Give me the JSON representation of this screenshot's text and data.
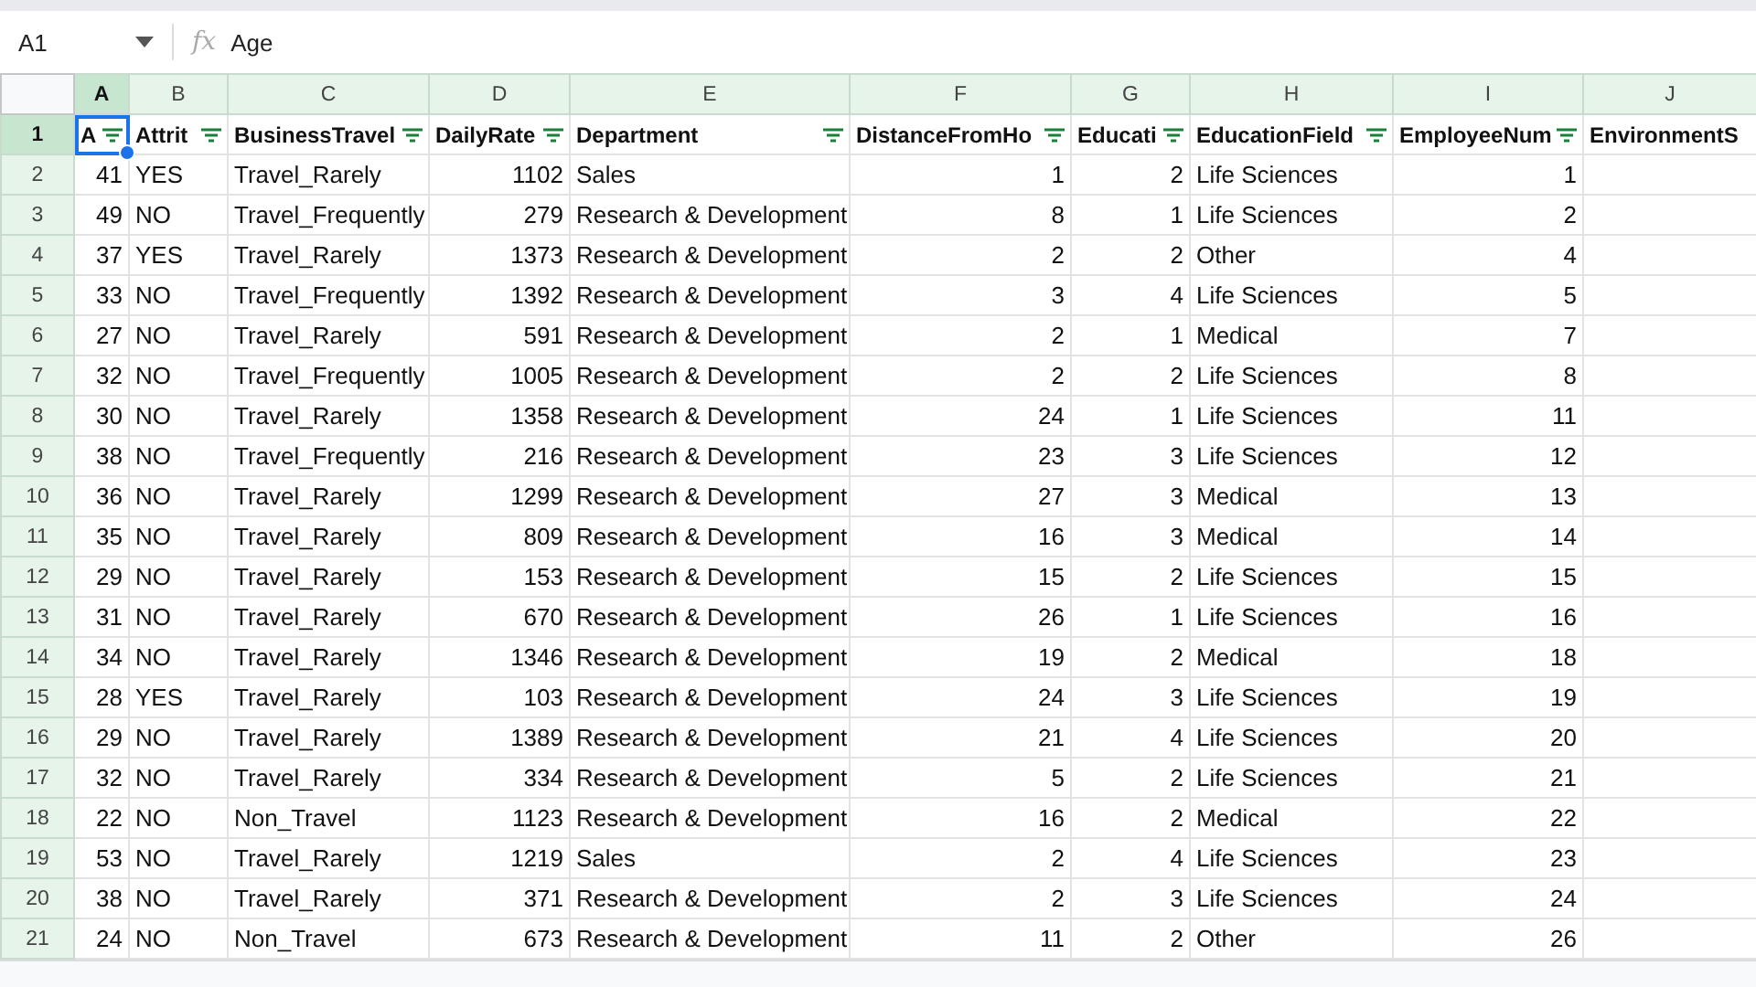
{
  "formula_bar": {
    "name_box": "A1",
    "fx": "fx",
    "value": "Age"
  },
  "column_headers": [
    {
      "letter": "A",
      "selected": true
    },
    {
      "letter": "B",
      "selected": false
    },
    {
      "letter": "C",
      "selected": false
    },
    {
      "letter": "D",
      "selected": false
    },
    {
      "letter": "E",
      "selected": false
    },
    {
      "letter": "F",
      "selected": false
    },
    {
      "letter": "G",
      "selected": false
    },
    {
      "letter": "H",
      "selected": false
    },
    {
      "letter": "I",
      "selected": false
    },
    {
      "letter": "J",
      "selected": false
    }
  ],
  "header_row": {
    "number": "1",
    "selected": true,
    "cells": [
      {
        "text": "A",
        "kind": "number",
        "filter": true,
        "selected": true
      },
      {
        "text": "Attrit",
        "kind": "text",
        "filter": true,
        "selected": false
      },
      {
        "text": "BusinessTravel",
        "kind": "text",
        "filter": true,
        "selected": false
      },
      {
        "text": "DailyRate",
        "kind": "number",
        "filter": true,
        "selected": false
      },
      {
        "text": "Department",
        "kind": "text",
        "filter": true,
        "selected": false
      },
      {
        "text": "DistanceFromHo",
        "kind": "number",
        "filter": true,
        "selected": false
      },
      {
        "text": "Educati",
        "kind": "number",
        "filter": true,
        "selected": false
      },
      {
        "text": "EducationField",
        "kind": "text",
        "filter": true,
        "selected": false
      },
      {
        "text": "EmployeeNum",
        "kind": "number",
        "filter": true,
        "selected": false
      },
      {
        "text": "EnvironmentS",
        "filter": false,
        "selected": false
      }
    ]
  },
  "rows": [
    {
      "number": "2",
      "selected": false,
      "cells": [
        "41",
        "YES",
        "Travel_Rarely",
        "1102",
        "Sales",
        "1",
        "2",
        "Life Sciences",
        "1"
      ]
    },
    {
      "number": "3",
      "selected": false,
      "cells": [
        "49",
        "NO",
        "Travel_Frequently",
        "279",
        "Research & Development",
        "8",
        "1",
        "Life Sciences",
        "2"
      ]
    },
    {
      "number": "4",
      "selected": false,
      "cells": [
        "37",
        "YES",
        "Travel_Rarely",
        "1373",
        "Research & Development",
        "2",
        "2",
        "Other",
        "4"
      ]
    },
    {
      "number": "5",
      "selected": false,
      "cells": [
        "33",
        "NO",
        "Travel_Frequently",
        "1392",
        "Research & Development",
        "3",
        "4",
        "Life Sciences",
        "5"
      ]
    },
    {
      "number": "6",
      "selected": false,
      "cells": [
        "27",
        "NO",
        "Travel_Rarely",
        "591",
        "Research & Development",
        "2",
        "1",
        "Medical",
        "7"
      ]
    },
    {
      "number": "7",
      "selected": false,
      "cells": [
        "32",
        "NO",
        "Travel_Frequently",
        "1005",
        "Research & Development",
        "2",
        "2",
        "Life Sciences",
        "8"
      ]
    },
    {
      "number": "8",
      "selected": false,
      "cells": [
        "30",
        "NO",
        "Travel_Rarely",
        "1358",
        "Research & Development",
        "24",
        "1",
        "Life Sciences",
        "11"
      ]
    },
    {
      "number": "9",
      "selected": false,
      "cells": [
        "38",
        "NO",
        "Travel_Frequently",
        "216",
        "Research & Development",
        "23",
        "3",
        "Life Sciences",
        "12"
      ]
    },
    {
      "number": "10",
      "selected": false,
      "cells": [
        "36",
        "NO",
        "Travel_Rarely",
        "1299",
        "Research & Development",
        "27",
        "3",
        "Medical",
        "13"
      ]
    },
    {
      "number": "11",
      "selected": false,
      "cells": [
        "35",
        "NO",
        "Travel_Rarely",
        "809",
        "Research & Development",
        "16",
        "3",
        "Medical",
        "14"
      ]
    },
    {
      "number": "12",
      "selected": false,
      "cells": [
        "29",
        "NO",
        "Travel_Rarely",
        "153",
        "Research & Development",
        "15",
        "2",
        "Life Sciences",
        "15"
      ]
    },
    {
      "number": "13",
      "selected": false,
      "cells": [
        "31",
        "NO",
        "Travel_Rarely",
        "670",
        "Research & Development",
        "26",
        "1",
        "Life Sciences",
        "16"
      ]
    },
    {
      "number": "14",
      "selected": false,
      "cells": [
        "34",
        "NO",
        "Travel_Rarely",
        "1346",
        "Research & Development",
        "19",
        "2",
        "Medical",
        "18"
      ]
    },
    {
      "number": "15",
      "selected": false,
      "cells": [
        "28",
        "YES",
        "Travel_Rarely",
        "103",
        "Research & Development",
        "24",
        "3",
        "Life Sciences",
        "19"
      ]
    },
    {
      "number": "16",
      "selected": false,
      "cells": [
        "29",
        "NO",
        "Travel_Rarely",
        "1389",
        "Research & Development",
        "21",
        "4",
        "Life Sciences",
        "20"
      ]
    },
    {
      "number": "17",
      "selected": false,
      "cells": [
        "32",
        "NO",
        "Travel_Rarely",
        "334",
        "Research & Development",
        "5",
        "2",
        "Life Sciences",
        "21"
      ]
    },
    {
      "number": "18",
      "selected": false,
      "cells": [
        "22",
        "NO",
        "Non_Travel",
        "1123",
        "Research & Development",
        "16",
        "2",
        "Medical",
        "22"
      ]
    },
    {
      "number": "19",
      "selected": false,
      "cells": [
        "53",
        "NO",
        "Travel_Rarely",
        "1219",
        "Sales",
        "2",
        "4",
        "Life Sciences",
        "23"
      ]
    },
    {
      "number": "20",
      "selected": false,
      "cells": [
        "38",
        "NO",
        "Travel_Rarely",
        "371",
        "Research & Development",
        "2",
        "3",
        "Life Sciences",
        "24"
      ]
    },
    {
      "number": "21",
      "selected": false,
      "cells": [
        "24",
        "NO",
        "Non_Travel",
        "673",
        "Research & Development",
        "11",
        "2",
        "Other",
        "26"
      ]
    }
  ]
}
